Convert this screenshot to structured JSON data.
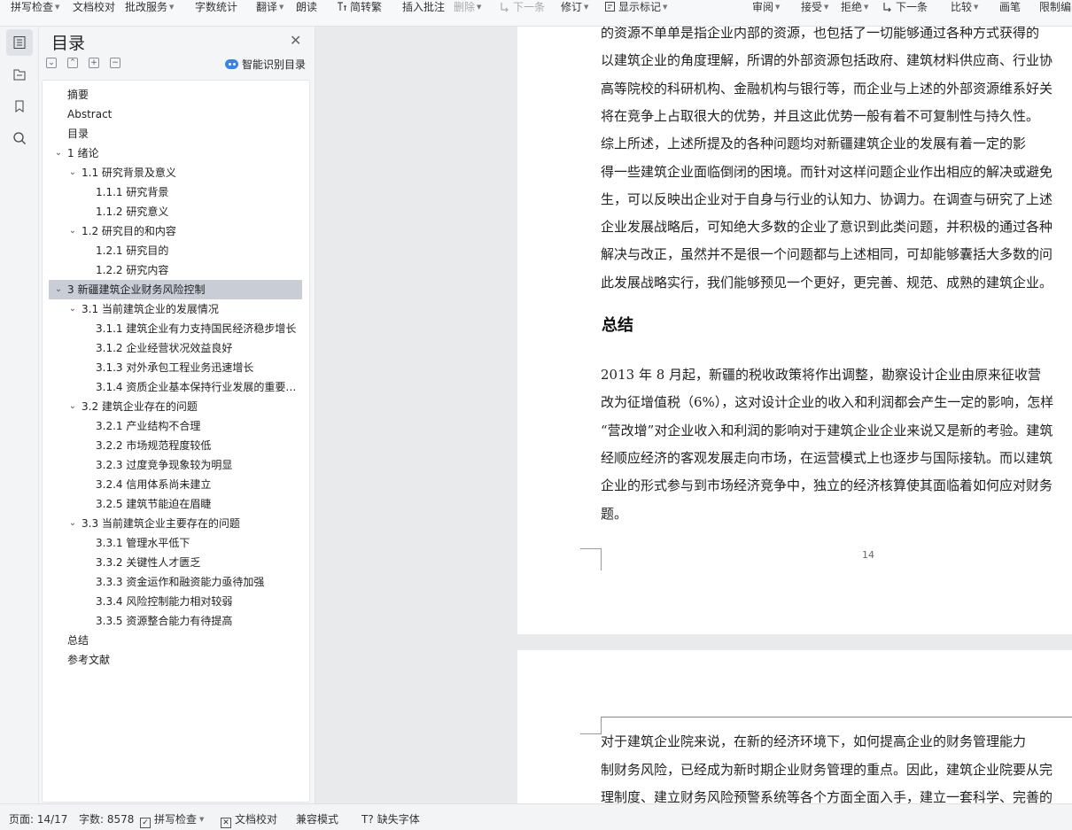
{
  "toolbar": {
    "items": [
      {
        "label": "拼写检查",
        "caret": true
      },
      {
        "label": "文档校对",
        "caret": false
      },
      {
        "label": "批改服务",
        "caret": true
      },
      {
        "label": "字数统计",
        "caret": false
      },
      {
        "label": "翻译",
        "caret": true
      },
      {
        "label": "朗读",
        "caret": false
      },
      {
        "label": "简转繁",
        "caret": false
      },
      {
        "label": "插入批注",
        "caret": false
      },
      {
        "label": "删除",
        "caret": true
      },
      {
        "label": "下一条",
        "caret": false
      },
      {
        "label": "修订",
        "caret": true
      },
      {
        "label": "显示标记",
        "caret": true
      },
      {
        "label": "审阅",
        "caret": true
      },
      {
        "label": "接受",
        "caret": true
      },
      {
        "label": "拒绝",
        "caret": true
      },
      {
        "label": "下一条",
        "caret": false
      },
      {
        "label": "比较",
        "caret": true
      },
      {
        "label": "画笔",
        "caret": false
      },
      {
        "label": "限制编",
        "caret": false
      }
    ]
  },
  "toc": {
    "title": "目录",
    "smart_label": "智能识别目录",
    "items": [
      {
        "label": "摘要",
        "level": 0,
        "chevron": false,
        "selected": false
      },
      {
        "label": "Abstract",
        "level": 0,
        "chevron": false,
        "selected": false
      },
      {
        "label": "目录",
        "level": 0,
        "chevron": false,
        "selected": false
      },
      {
        "label": "1  绪论",
        "level": 0,
        "chevron": true,
        "selected": false
      },
      {
        "label": "1.1  研究背景及意义",
        "level": 1,
        "chevron": true,
        "selected": false
      },
      {
        "label": "1.1.1 研究背景",
        "level": 2,
        "chevron": false,
        "selected": false
      },
      {
        "label": "1.1.2 研究意义",
        "level": 2,
        "chevron": false,
        "selected": false
      },
      {
        "label": "1.2 研究目的和内容",
        "level": 1,
        "chevron": true,
        "selected": false
      },
      {
        "label": "1.2.1 研究目的",
        "level": 2,
        "chevron": false,
        "selected": false
      },
      {
        "label": "1.2.2 研究内容",
        "level": 2,
        "chevron": false,
        "selected": false
      },
      {
        "label": "3  新疆建筑企业财务风险控制",
        "level": 0,
        "chevron": true,
        "selected": true
      },
      {
        "label": "3.1  当前建筑企业的发展情况",
        "level": 1,
        "chevron": true,
        "selected": false
      },
      {
        "label": "3.1.1 建筑企业有力支持国民经济稳步增长",
        "level": 2,
        "chevron": false,
        "selected": false
      },
      {
        "label": "3.1.2 企业经营状况效益良好",
        "level": 2,
        "chevron": false,
        "selected": false
      },
      {
        "label": "3.1.3  对外承包工程业务迅速增长",
        "level": 2,
        "chevron": false,
        "selected": false
      },
      {
        "label": "3.1.4  资质企业基本保持行业发展的重要地位",
        "level": 2,
        "chevron": false,
        "selected": false
      },
      {
        "label": "3.2 建筑企业存在的问题",
        "level": 1,
        "chevron": true,
        "selected": false
      },
      {
        "label": "3.2.1 产业结构不合理",
        "level": 2,
        "chevron": false,
        "selected": false
      },
      {
        "label": "3.2.2 市场规范程度较低",
        "level": 2,
        "chevron": false,
        "selected": false
      },
      {
        "label": "3.2.3 过度竞争现象较为明显",
        "level": 2,
        "chevron": false,
        "selected": false
      },
      {
        "label": "3.2.4 信用体系尚未建立",
        "level": 2,
        "chevron": false,
        "selected": false
      },
      {
        "label": "3.2.5 建筑节能迫在眉睫",
        "level": 2,
        "chevron": false,
        "selected": false
      },
      {
        "label": "3.3 当前建筑企业主要存在的问题",
        "level": 1,
        "chevron": true,
        "selected": false
      },
      {
        "label": "3.3.1 管理水平低下",
        "level": 2,
        "chevron": false,
        "selected": false
      },
      {
        "label": "3.3.2 关键性人才匮乏",
        "level": 2,
        "chevron": false,
        "selected": false
      },
      {
        "label": "3.3.3 资金运作和融资能力亟待加强",
        "level": 2,
        "chevron": false,
        "selected": false
      },
      {
        "label": "3.3.4 风险控制能力相对较弱",
        "level": 2,
        "chevron": false,
        "selected": false
      },
      {
        "label": "3.3.5 资源整合能力有待提高",
        "level": 2,
        "chevron": false,
        "selected": false
      },
      {
        "label": "总结",
        "level": 0,
        "chevron": false,
        "selected": false
      },
      {
        "label": "参考文献",
        "level": 0,
        "chevron": false,
        "selected": false
      }
    ]
  },
  "document": {
    "page1_lines": [
      "的资源不单单是指企业内部的资源，也包括了一切能够通过各种方式获得的",
      "以建筑企业的角度理解，所谓的外部资源包括政府、建筑材料供应商、行业协",
      "高等院校的科研机构、金融机构与银行等，而企业与上述的外部资源维系好关",
      "将在竞争上占取很大的优势，并且这此优势一般有着不可复制性与持久性。",
      "    综上所述，上述所提及的各种问题均对新疆建筑企业的发展有着一定的影",
      "得一些建筑企业面临倒闭的困境。而针对这样问题企业作出相应的解决或避免",
      "生，可以反映出企业对于自身与行业的认知力、协调力。在调查与研究了上述",
      "企业发展战略后，可知绝大多数的企业了意识到此类问题，并积极的通过各种",
      "解决与改正，虽然并不是很一个问题都与上述相同，可却能够囊括大多数的问",
      "此发展战略实行，我们能够预见一个更好，更完善、规范、成熟的建筑企业。"
    ],
    "heading": "总结",
    "page1_lines2": [
      "    2013 年 8 月起，新疆的税收政策将作出调整，勘察设计企业由原来征收营",
      "改为征增值税（6%），这对设计企业的收入和利润都会产生一定的影响，怎样",
      "“营改增”对企业收入和利润的影响对于建筑企业企业来说又是新的考验。建筑",
      "经顺应经济的客观发展走向市场，在运营模式上也逐步与国际接轨。而以建筑",
      "企业的形式参与到市场经济竞争中，独立的经济核算使其面临着如何应对财务",
      "题。"
    ],
    "page_number": "14",
    "page2_lines": [
      "    对于建筑企业院来说，在新的经济环境下，如何提高企业的财务管理能力",
      "制财务风险，已经成为新时期企业财务管理的重点。因此，建筑企业院要从完",
      "理制度、建立财务风险预警系统等各个方面全面入手，建立一套科学、完善的"
    ]
  },
  "status": {
    "page": "页面: 14/17",
    "words": "字数: 8578",
    "spell": "拼写检查",
    "proof": "文档校对",
    "compat": "兼容模式",
    "missing_font": "缺失字体"
  }
}
